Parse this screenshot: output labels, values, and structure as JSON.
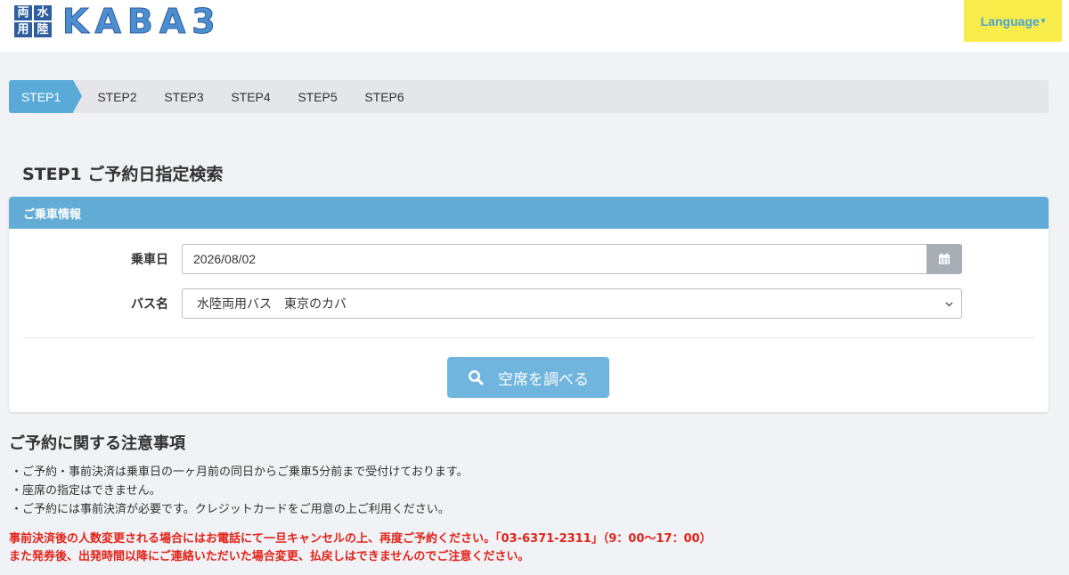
{
  "header": {
    "logo_chars": [
      "両",
      "水",
      "用",
      "陸"
    ],
    "logo_text": "KABA3",
    "language_label": "Language",
    "language_caret": "▾"
  },
  "steps": [
    "STEP1",
    "STEP2",
    "STEP3",
    "STEP4",
    "STEP5",
    "STEP6"
  ],
  "page_title": "STEP1 ご予約日指定検索",
  "panel": {
    "title": "ご乗車情報",
    "date_label": "乗車日",
    "date_value": "2026/08/02",
    "bus_label": "バス名",
    "bus_value": "水陸両用バス　東京のカバ",
    "search_label": "空席を調べる"
  },
  "notes": {
    "title": "ご予約に関する注意事項",
    "items": [
      "・ご予約・事前決済は乗車日の一ヶ月前の同日からご乗車5分前まで受付けております。",
      "・座席の指定はできません。",
      "・ご予約には事前決済が必要です。クレジットカードをご用意の上ご利用ください。"
    ],
    "warnings": [
      "事前決済後の人数変更される場合にはお電話にて一旦キャンセルの上、再度ご予約ください。「03-6371-2311」（9：00〜17：00）",
      "また発券後、出発時間以降にご連絡いただいた場合変更、払戻しはできませんのでご注意ください。"
    ]
  },
  "colors": {
    "accent": "#5aaad7",
    "panel_header": "#62acd6",
    "language_bg": "#f7ec4a",
    "warning": "#e2231a"
  }
}
